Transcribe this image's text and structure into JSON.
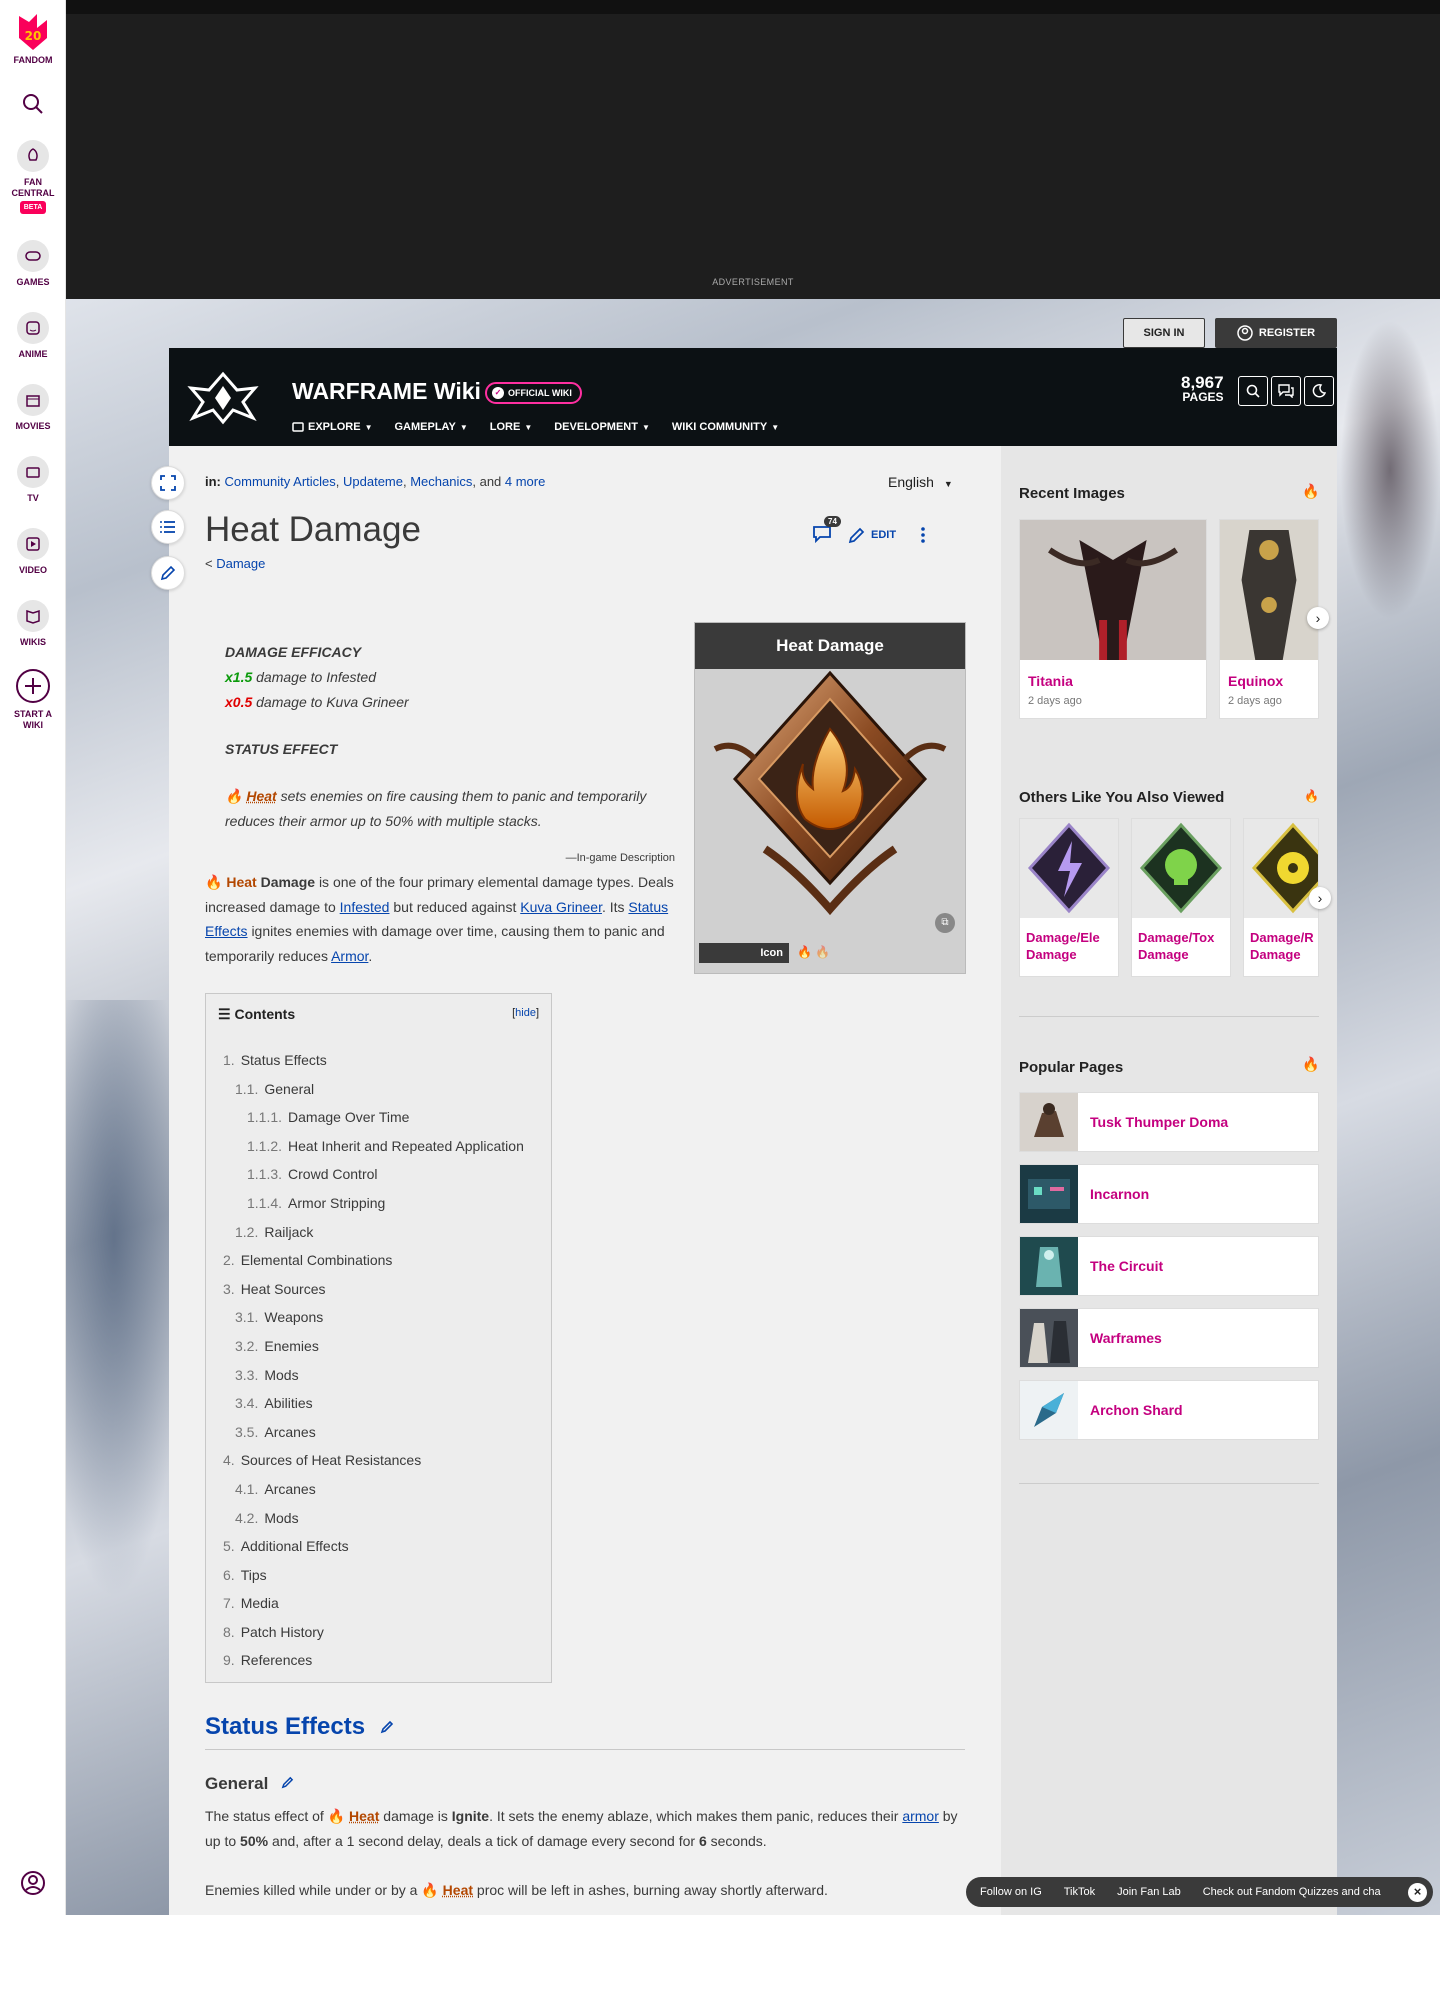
{
  "global_nav": {
    "fandom_badge": "20",
    "fandom_label": "FANDOM",
    "fan_central": "FAN CENTRAL",
    "beta": "BETA",
    "games": "GAMES",
    "anime": "ANIME",
    "movies": "MOVIES",
    "tv": "TV",
    "video": "VIDEO",
    "wikis": "WIKIS",
    "start_wiki": "START A WIKI"
  },
  "ad": {
    "label": "ADVERTISEMENT"
  },
  "account": {
    "sign_in": "SIGN IN",
    "register": "REGISTER"
  },
  "community": {
    "name": "WARFRAME Wiki",
    "official": "OFFICIAL WIKI",
    "tabs": [
      "EXPLORE",
      "GAMEPLAY",
      "LORE",
      "DEVELOPMENT",
      "WIKI COMMUNITY"
    ],
    "page_count": "8,967",
    "page_label": "PAGES"
  },
  "article": {
    "categories_prefix": "in:",
    "categories": [
      "Community Articles",
      "Updateme",
      "Mechanics"
    ],
    "categories_more": "4 more",
    "language": "English",
    "title": "Heat Damage",
    "parent_prefix": "<",
    "parent": "Damage",
    "comment_count": "74",
    "edit_label": "EDIT",
    "quote": {
      "efficacy_head": "DAMAGE EFFICACY",
      "bonus_mult": "x1.5",
      "bonus_text": "damage to Infested",
      "penalty_mult": "x0.5",
      "penalty_text": "damage to Kuva Grineer",
      "status_head": "STATUS EFFECT",
      "status_link": "Heat",
      "status_text": "sets enemies on fire causing them to panic and temporarily reduces their armor up to 50% with multiple stacks.",
      "source": "—In-game Description"
    },
    "intro": {
      "heat": "Heat",
      "damage": "Damage",
      "t1": "is one of the four primary elemental damage types. Deals increased damage to",
      "infested": "Infested",
      "t2": "but reduced against",
      "kuva": "Kuva Grineer",
      "t3": ". Its",
      "status_effects": "Status Effects",
      "t4": "ignites enemies with damage over time, causing them to panic and temporarily reduces",
      "armor": "Armor",
      "t5": "."
    },
    "infobox": {
      "title": "Heat Damage",
      "icon_label": "Icon"
    },
    "toc": {
      "title": "Contents",
      "hide": "hide",
      "items": [
        {
          "n": "1.",
          "t": "Status Effects",
          "lvl": 1
        },
        {
          "n": "1.1.",
          "t": "General",
          "lvl": 2
        },
        {
          "n": "1.1.1.",
          "t": "Damage Over Time",
          "lvl": 3
        },
        {
          "n": "1.1.2.",
          "t": "Heat Inherit and Repeated Application",
          "lvl": 3
        },
        {
          "n": "1.1.3.",
          "t": "Crowd Control",
          "lvl": 3
        },
        {
          "n": "1.1.4.",
          "t": "Armor Stripping",
          "lvl": 3
        },
        {
          "n": "1.2.",
          "t": "Railjack",
          "lvl": 2
        },
        {
          "n": "2.",
          "t": "Elemental Combinations",
          "lvl": 1
        },
        {
          "n": "3.",
          "t": "Heat Sources",
          "lvl": 1
        },
        {
          "n": "3.1.",
          "t": "Weapons",
          "lvl": 2
        },
        {
          "n": "3.2.",
          "t": "Enemies",
          "lvl": 2
        },
        {
          "n": "3.3.",
          "t": "Mods",
          "lvl": 2
        },
        {
          "n": "3.4.",
          "t": "Abilities",
          "lvl": 2
        },
        {
          "n": "3.5.",
          "t": "Arcanes",
          "lvl": 2
        },
        {
          "n": "4.",
          "t": "Sources of Heat Resistances",
          "lvl": 1
        },
        {
          "n": "4.1.",
          "t": "Arcanes",
          "lvl": 2
        },
        {
          "n": "4.2.",
          "t": "Mods",
          "lvl": 2
        },
        {
          "n": "5.",
          "t": "Additional Effects",
          "lvl": 1
        },
        {
          "n": "6.",
          "t": "Tips",
          "lvl": 1
        },
        {
          "n": "7.",
          "t": "Media",
          "lvl": 1
        },
        {
          "n": "8.",
          "t": "Patch History",
          "lvl": 1
        },
        {
          "n": "9.",
          "t": "References",
          "lvl": 1
        }
      ]
    },
    "section_status": "Status Effects",
    "section_general": "General",
    "general_p1": {
      "t1": "The status effect of",
      "heat": "Heat",
      "t2": "damage is",
      "ignite": "Ignite",
      "t3": ". It sets the enemy ablaze, which makes them panic, reduces their",
      "armor": "armor",
      "t4": "by up to",
      "pct": "50%",
      "t5": "and, after a 1 second delay, deals a tick of damage every second for",
      "six": "6",
      "t6": "seconds."
    },
    "general_p2": {
      "t1": "Enemies killed while under or by a",
      "heat": "Heat",
      "t2": "proc will be left in ashes, burning away shortly afterward."
    }
  },
  "rail": {
    "recent_images": "Recent Images",
    "recent": [
      {
        "title": "Titania",
        "when": "2 days ago"
      },
      {
        "title": "Equinox",
        "when": "2 days ago"
      }
    ],
    "others_viewed": "Others Like You Also Viewed",
    "others": [
      {
        "title": "Damage/Ele Damage",
        "line1": "Damage/Ele",
        "line2": "Damage"
      },
      {
        "title": "Damage/Tox Damage",
        "line1": "Damage/Tox",
        "line2": "Damage"
      },
      {
        "title": "Damage/R Damage",
        "line1": "Damage/R",
        "line2": "Damage"
      }
    ],
    "popular_pages": "Popular Pages",
    "popular": [
      "Tusk Thumper Doma",
      "Incarnon",
      "The Circuit",
      "Warframes",
      "Archon Shard"
    ]
  },
  "toolbar": {
    "items": [
      "Follow on IG",
      "TikTok",
      "Join Fan Lab",
      "Check out Fandom Quizzes and cha"
    ]
  }
}
